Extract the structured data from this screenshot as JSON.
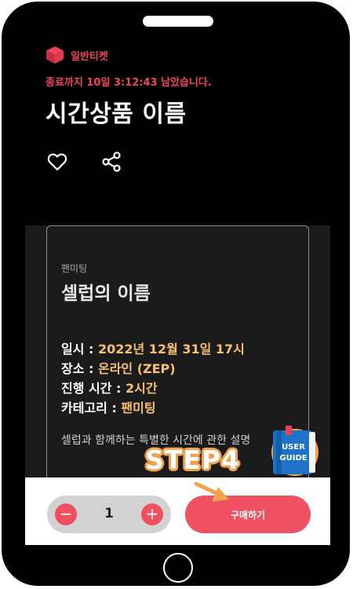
{
  "header": {
    "brand_label": "일반티켓",
    "countdown": "종료까지 10일 3:12:43 남았습니다.",
    "title": "시간상품 이름"
  },
  "card": {
    "category": "팬미팅",
    "name": "셀럽의 이름",
    "rows": [
      {
        "label": "일시 : ",
        "value": "2022년 12월 31일 17시"
      },
      {
        "label": "장소 : ",
        "value": "온라인 (ZEP)"
      },
      {
        "label": "진행 시간 : ",
        "value": "2시간"
      },
      {
        "label": "카테고리 : ",
        "value": "팬미팅"
      }
    ],
    "description": "셀럽과 함께하는 특별한 시간에 관한 설명"
  },
  "purchase": {
    "minus": "−",
    "quantity": "1",
    "plus": "+",
    "buy_label": "구매하기"
  },
  "overlay": {
    "step_label": "STEP4",
    "guide_line1": "USER",
    "guide_line2": "GUIDE"
  },
  "colors": {
    "accent": "#ef5162",
    "highlight": "#f8c06b",
    "annotation": "#f2a24a"
  },
  "icons": {
    "brand": "red-box-icon",
    "like": "heart-icon",
    "share": "share-icon",
    "guide": "book-icon"
  }
}
